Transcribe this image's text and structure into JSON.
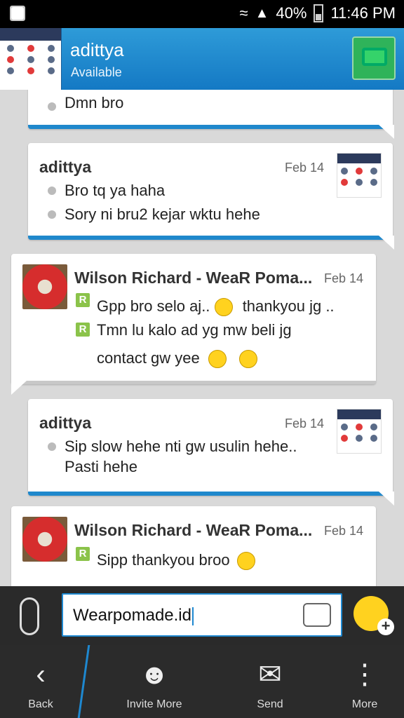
{
  "statusbar": {
    "battery": "40%",
    "time": "11:46 PM"
  },
  "header": {
    "name": "adittya",
    "status": "Available"
  },
  "messages": [
    {
      "lines": [
        "Dmn bro"
      ]
    },
    {
      "sender": "adittya",
      "date": "Feb 14",
      "lines": [
        "Bro tq ya haha",
        "Sory ni bru2 kejar wktu hehe"
      ]
    },
    {
      "sender": "Wilson Richard - WeaR Poma...",
      "date": "Feb 14",
      "lines": [
        "Gpp bro selo aj..",
        "thankyou jg ..",
        "Tmn lu kalo ad yg mw beli jg",
        "contact gw yee"
      ]
    },
    {
      "sender": "adittya",
      "date": "Feb 14",
      "lines": [
        "Sip slow hehe nti gw usulin hehe..",
        "Pasti hehe"
      ]
    },
    {
      "sender": "Wilson Richard - WeaR Poma...",
      "date": "Feb 14",
      "lines": [
        "Sipp thankyou broo"
      ]
    }
  ],
  "composer": {
    "value": "Wearpomade.id"
  },
  "toolbar": {
    "back": "Back",
    "invite": "Invite More",
    "send": "Send",
    "more": "More"
  },
  "icons": {
    "r_badge": "R"
  },
  "colors": {
    "accent": "#1f88cc",
    "header": "#1a86cf"
  }
}
